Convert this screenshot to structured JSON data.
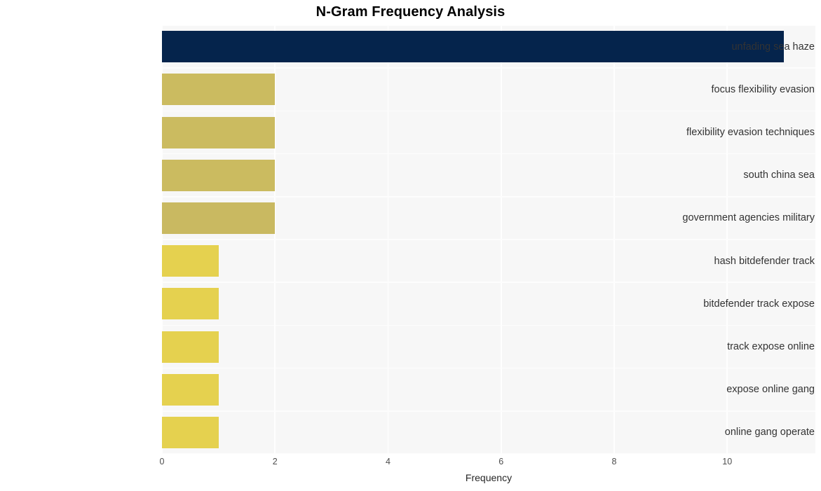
{
  "chart": {
    "title": "N-Gram Frequency Analysis",
    "xlabel": "Frequency",
    "ylabel": ""
  },
  "chart_data": {
    "type": "bar",
    "orientation": "horizontal",
    "title": "N-Gram Frequency Analysis",
    "xlabel": "Frequency",
    "ylabel": "",
    "categories": [
      "unfading sea haze",
      "focus flexibility evasion",
      "flexibility evasion techniques",
      "south china sea",
      "government agencies military",
      "hash bitdefender track",
      "bitdefender track expose",
      "track expose online",
      "expose online gang",
      "online gang operate"
    ],
    "values": [
      11,
      2,
      2,
      2,
      2,
      1,
      1,
      1,
      1,
      1
    ],
    "bar_colors": [
      "#05244c",
      "#cbbb60",
      "#cbbb60",
      "#cbbb60",
      "#c9b961",
      "#e5d14f",
      "#e5d14f",
      "#e5d14f",
      "#e5d14f",
      "#e5d14f"
    ],
    "xlim": [
      0,
      11.56
    ],
    "xticks": [
      0,
      2,
      4,
      6,
      8,
      10
    ],
    "xtick_labels": [
      "0",
      "2",
      "4",
      "6",
      "8",
      "10"
    ],
    "grid": true,
    "grid_color": "#ffffff",
    "plot_background": "#f7f7f7",
    "figure_background": "#ffffff",
    "legend": null
  }
}
